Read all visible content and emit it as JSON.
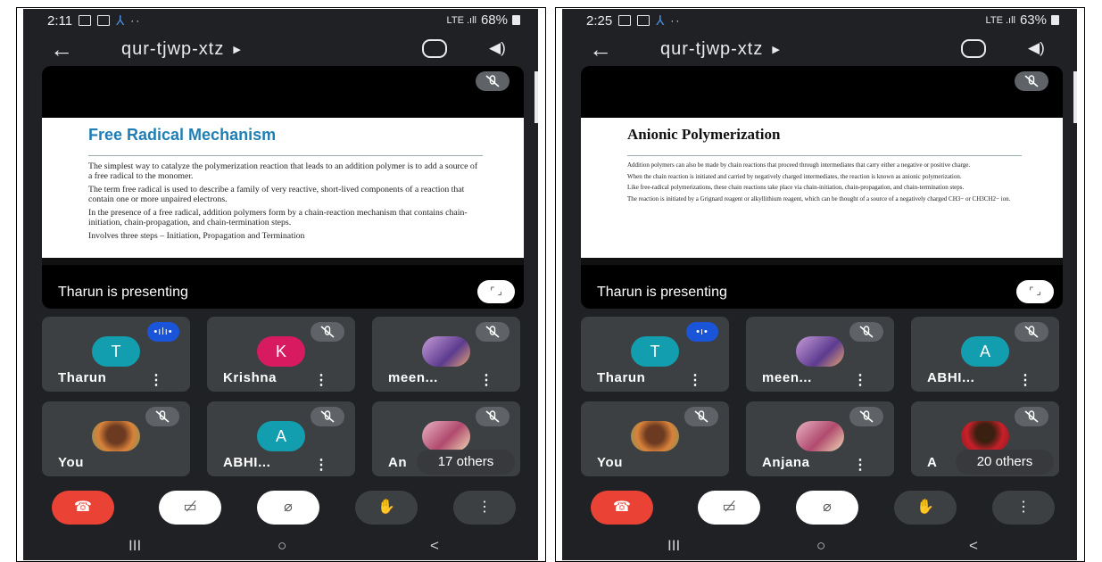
{
  "screens": [
    {
      "status": {
        "time": "2:11",
        "dots": "··",
        "network": "LTE .ıll",
        "battery": "68%"
      },
      "meeting_code": "qur-tjwp-xtz",
      "presentation": {
        "slide_title": "Free Radical Mechanism",
        "paragraphs": [
          "The simplest way to catalyze the polymerization reaction that leads to an addition polymer is to add a source of a free radical to the monomer.",
          "The term free radical is used to describe a family of very reactive, short-lived components of a reaction that contain one or more unpaired electrons.",
          "In the presence of a free radical, addition polymers form by a chain-reaction mechanism that contains chain-initiation, chain-propagation, and chain-termination steps.",
          "Involves three steps – Initiation, Propagation and Termination"
        ],
        "presenter_label": "Tharun is presenting"
      },
      "participants": [
        {
          "name": "Tharun",
          "initial": "T",
          "color": "#129eaf",
          "speaking": true
        },
        {
          "name": "Krishna",
          "initial": "K",
          "color": "#d81b60"
        },
        {
          "name": "meen...",
          "photo": "purple"
        },
        {
          "name": "You",
          "photo": "orange"
        },
        {
          "name": "ABHI...",
          "initial": "A",
          "color": "#129eaf"
        },
        {
          "name": "An",
          "photo": "pink",
          "others": "17 others"
        }
      ]
    },
    {
      "status": {
        "time": "2:25",
        "dots": "··",
        "network": "LTE .ıll",
        "battery": "63%"
      },
      "meeting_code": "qur-tjwp-xtz",
      "presentation": {
        "slide_title": "Anionic Polymerization",
        "paragraphs": [
          "Addition polymers can also be made by chain reactions that proceed through intermediates that carry either a negative or positive charge.",
          "When the chain reaction is initiated and carried by negatively charged intermediates, the reaction is known as anionic polymerization.",
          "Like free-radical polymerizations, these chain reactions take place via chain-initiation, chain-propagation, and chain-termination steps.",
          "The reaction is initiated by a Grignard reagent or alkyllithium reagent, which can be thought of a source of a negatively charged CH3− or CH3CH2− ion."
        ],
        "presenter_label": "Tharun is presenting"
      },
      "participants": [
        {
          "name": "Tharun",
          "initial": "T",
          "color": "#129eaf",
          "speaking": true
        },
        {
          "name": "meen...",
          "photo": "purple"
        },
        {
          "name": "ABHI...",
          "initial": "A",
          "color": "#129eaf"
        },
        {
          "name": "You",
          "photo": "orange"
        },
        {
          "name": "Anjana",
          "photo": "pink"
        },
        {
          "name": "A",
          "photo": "red",
          "others": "20 others"
        }
      ]
    }
  ],
  "icons": {
    "back": "arrow-left-icon",
    "switch_camera": "switch-camera-icon",
    "speaker": "speaker-icon",
    "mic_off": "mic-off-icon",
    "fullscreen": "fullscreen-icon",
    "end_call": "end-call-icon",
    "camera_off": "camera-off-icon",
    "raise_hand": "raise-hand-icon",
    "more": "more-vert-icon"
  },
  "nav": {
    "recents": "III",
    "home": "○",
    "back": "<"
  }
}
